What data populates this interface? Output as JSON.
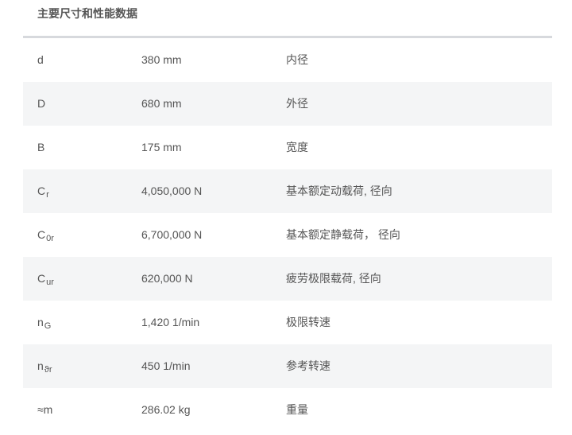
{
  "section": {
    "title": "主要尺寸和性能数据"
  },
  "rows": [
    {
      "symbol": "d",
      "sub": "",
      "value": "380 mm",
      "description": "内径"
    },
    {
      "symbol": "D",
      "sub": "",
      "value": "680 mm",
      "description": "外径"
    },
    {
      "symbol": "B",
      "sub": "",
      "value": "175 mm",
      "description": "宽度"
    },
    {
      "symbol": "C",
      "sub": "r",
      "value": "4,050,000 N",
      "description": "基本额定动载荷, 径向"
    },
    {
      "symbol": "C",
      "sub": "0r",
      "value": "6,700,000 N",
      "description": "基本额定静载荷， 径向"
    },
    {
      "symbol": "C",
      "sub": "ur",
      "value": "620,000 N",
      "description": "疲劳极限载荷, 径向"
    },
    {
      "symbol": "n",
      "sub": "G",
      "value": "1,420 1/min",
      "description": "极限转速"
    },
    {
      "symbol": "n",
      "sub": "ϑr",
      "value": "450 1/min",
      "description": "参考转速"
    },
    {
      "symbol": "≈m",
      "sub": "",
      "value": "286.02 kg",
      "description": "重量"
    }
  ],
  "colors": {
    "text": "#555555",
    "row_shade": "#f4f5f6",
    "rule": "#d7d9dd"
  }
}
